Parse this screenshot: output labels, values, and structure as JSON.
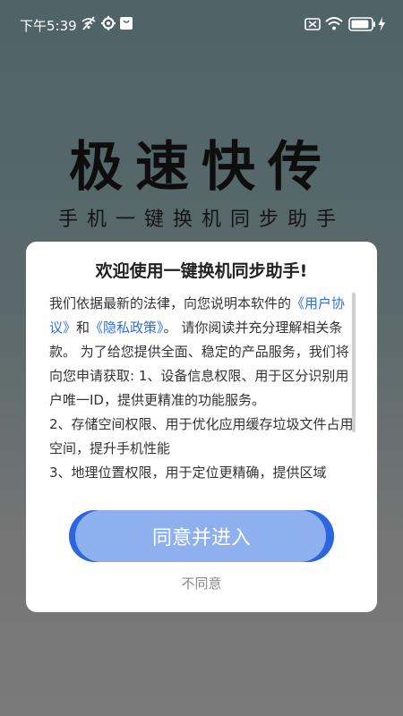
{
  "status_bar": {
    "time": "下午5:39",
    "battery_level": 0.9
  },
  "hero": {
    "title": "极速快传",
    "subtitle": "手机一键换机同步助手"
  },
  "dialog": {
    "title": "欢迎使用一键换机同步助手!",
    "body": {
      "p1_a": "我们依据最新的法律，向您说明本软件的",
      "link_user_agreement": "《用户协议》",
      "p1_b": "和",
      "link_privacy_policy": "《隐私政策》",
      "p1_c": "。 请你阅读并充分理解相关条款。 为了给您提供全面、稳定的产品服务，我们将向您申请获取: 1、设备信息权限、用于区分识别用户唯一ID，提供更精准的功能服务。",
      "p2": "2、存储空间权限、用于优化应用缓存垃圾文件占用空间，提升手机性能",
      "p3": "3、地理位置权限，用于定位更精确，提供区域"
    },
    "agree_label": "同意并进入",
    "disagree_label": "不同意"
  }
}
